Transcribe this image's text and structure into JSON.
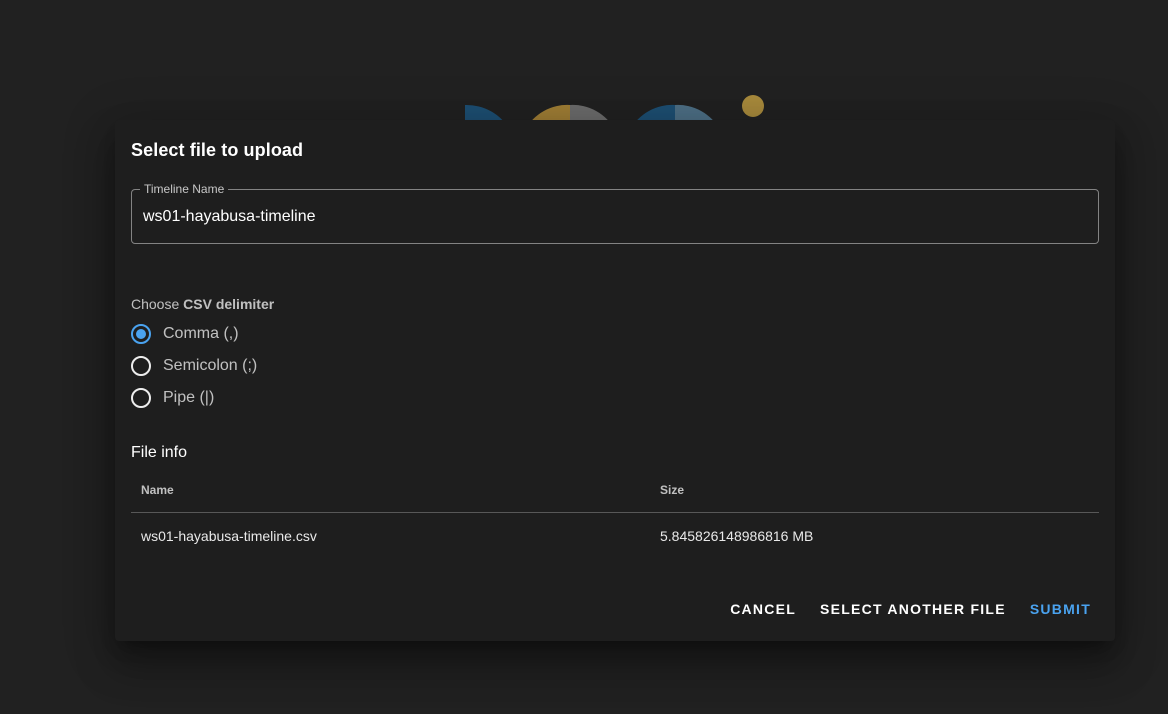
{
  "dialog": {
    "title": "Select file to upload",
    "timeline_name": {
      "label": "Timeline Name",
      "value": "ws01-hayabusa-timeline"
    },
    "csv_delimiter": {
      "prefix": "Choose ",
      "emphasis": "CSV delimiter",
      "options": [
        {
          "label": "Comma (,)",
          "checked": true
        },
        {
          "label": "Semicolon (;)",
          "checked": false
        },
        {
          "label": "Pipe (|)",
          "checked": false
        }
      ]
    },
    "file_info": {
      "title": "File info",
      "columns": [
        "Name",
        "Size"
      ],
      "rows": [
        {
          "name": "ws01-hayabusa-timeline.csv",
          "size": "5.845826148986816 MB"
        }
      ]
    },
    "actions": {
      "cancel": "Cancel",
      "select_another": "Select another file",
      "submit": "Submit"
    }
  },
  "colors": {
    "background": "#212121",
    "dialog": "#1e1e1e",
    "accent": "#4aa3f0"
  }
}
